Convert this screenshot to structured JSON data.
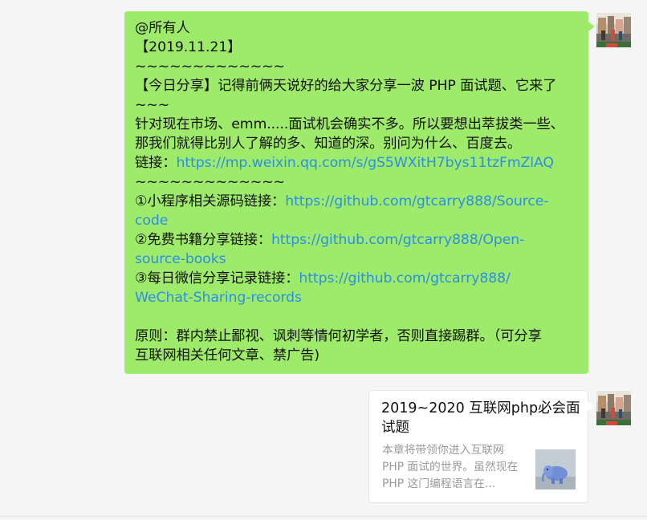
{
  "message": {
    "lines": [
      {
        "text": "@所有人"
      },
      {
        "text": "【2019.11.21】"
      },
      {
        "text": "~~~~~~~~~~~~~"
      },
      {
        "text": "【今日分享】记得前俩天说好的给大家分享一波 PHP 面试题、它来了"
      },
      {
        "text": "~~~"
      },
      {
        "text": "针对现在市场、emm.....面试机会确实不多。所以要想出萃拔类一些、"
      },
      {
        "text": "那我们就得比别人了解的多、知道的深。别问为什么、百度去。"
      },
      {
        "label": "链接：",
        "link": "https://mp.weixin.qq.com/s/gS5WXitH7bys11tzFmZlAQ"
      },
      {
        "text": "~~~~~~~~~~~~~"
      },
      {
        "label": "①小程序相关源码链接：",
        "link": "https://github.com/gtcarry888/Source-"
      },
      {
        "link": "code"
      },
      {
        "label": "②免费书籍分享链接：",
        "link": "https://github.com/gtcarry888/Open-"
      },
      {
        "link": "source-books"
      },
      {
        "label": "③每日微信分享记录链接：",
        "link": "https://github.com/gtcarry888/"
      },
      {
        "link": "WeChat-Sharing-records"
      },
      {
        "text": ""
      },
      {
        "text": "原则：群内禁止鄙视、讽刺等情何初学者，否则直接踢群。（可分享"
      },
      {
        "text": "互联网相关任何文章、禁广告)"
      }
    ]
  },
  "card": {
    "title": "2019~2020 互联网php必会面试题",
    "description": "本章将带领你进入互联网PHP 面试的世界。虽然现在 PHP 这门编程语言在..."
  },
  "icons": {
    "avatar": "user-avatar-photo",
    "thumbnail": "php-elephant-thumbnail"
  },
  "colors": {
    "bubble": "#9eea6a",
    "link": "#2b8fe6",
    "background": "#f5f5f5",
    "card": "#ffffff"
  }
}
